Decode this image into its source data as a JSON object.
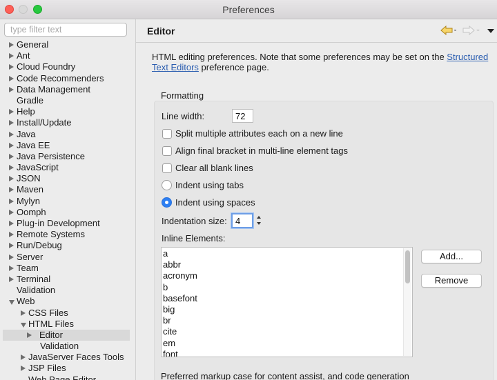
{
  "window": {
    "title": "Preferences"
  },
  "filter": {
    "placeholder": "type filter text"
  },
  "tree": [
    {
      "label": "General",
      "arrow": "closed",
      "level": 0
    },
    {
      "label": "Ant",
      "arrow": "closed",
      "level": 0
    },
    {
      "label": "Cloud Foundry",
      "arrow": "closed",
      "level": 0
    },
    {
      "label": "Code Recommenders",
      "arrow": "closed",
      "level": 0
    },
    {
      "label": "Data Management",
      "arrow": "closed",
      "level": 0
    },
    {
      "label": "Gradle",
      "arrow": "none",
      "level": 0
    },
    {
      "label": "Help",
      "arrow": "closed",
      "level": 0
    },
    {
      "label": "Install/Update",
      "arrow": "closed",
      "level": 0
    },
    {
      "label": "Java",
      "arrow": "closed",
      "level": 0
    },
    {
      "label": "Java EE",
      "arrow": "closed",
      "level": 0
    },
    {
      "label": "Java Persistence",
      "arrow": "closed",
      "level": 0
    },
    {
      "label": "JavaScript",
      "arrow": "closed",
      "level": 0
    },
    {
      "label": "JSON",
      "arrow": "closed",
      "level": 0
    },
    {
      "label": "Maven",
      "arrow": "closed",
      "level": 0
    },
    {
      "label": "Mylyn",
      "arrow": "closed",
      "level": 0
    },
    {
      "label": "Oomph",
      "arrow": "closed",
      "level": 0
    },
    {
      "label": "Plug-in Development",
      "arrow": "closed",
      "level": 0
    },
    {
      "label": "Remote Systems",
      "arrow": "closed",
      "level": 0
    },
    {
      "label": "Run/Debug",
      "arrow": "closed",
      "level": 0
    },
    {
      "label": "Server",
      "arrow": "closed",
      "level": 0
    },
    {
      "label": "Team",
      "arrow": "closed",
      "level": 0
    },
    {
      "label": "Terminal",
      "arrow": "closed",
      "level": 0
    },
    {
      "label": "Validation",
      "arrow": "none",
      "level": 0
    },
    {
      "label": "Web",
      "arrow": "open",
      "level": 0
    },
    {
      "label": "CSS Files",
      "arrow": "closed",
      "level": 1
    },
    {
      "label": "HTML Files",
      "arrow": "open",
      "level": 1
    },
    {
      "label": "Editor",
      "arrow": "closed",
      "level": 2,
      "selected": true
    },
    {
      "label": "Validation",
      "arrow": "none",
      "level": 2
    },
    {
      "label": "JavaServer Faces Tools",
      "arrow": "closed",
      "level": 1
    },
    {
      "label": "JSP Files",
      "arrow": "closed",
      "level": 1
    },
    {
      "label": "Web Page Editor",
      "arrow": "none",
      "level": 1
    }
  ],
  "editor": {
    "title": "Editor",
    "desc_prefix": "HTML editing preferences.  Note that some preferences may be set on the ",
    "desc_link": "Structured Text Editors",
    "desc_suffix": " preference page.",
    "formatting_label": "Formatting",
    "line_width_label": "Line width:",
    "line_width_value": "72",
    "opt_split": "Split multiple attributes each on a new line",
    "opt_align": "Align final bracket in multi-line element tags",
    "opt_clear": "Clear all blank lines",
    "opt_tabs": "Indent using tabs",
    "opt_spaces": "Indent using spaces",
    "indent_label": "Indentation size:",
    "indent_value": "4",
    "inline_label": "Inline Elements:",
    "inline_elements": [
      "a",
      "abbr",
      "acronym",
      "b",
      "basefont",
      "big",
      "br",
      "cite",
      "em",
      "font"
    ],
    "add_label": "Add...",
    "remove_label": "Remove",
    "footer_label": "Preferred markup case for content assist, and code generation"
  },
  "colors": {
    "accent": "#2d7ff2",
    "link": "#2a5db0",
    "nav_arrow": "#e3b43c"
  }
}
